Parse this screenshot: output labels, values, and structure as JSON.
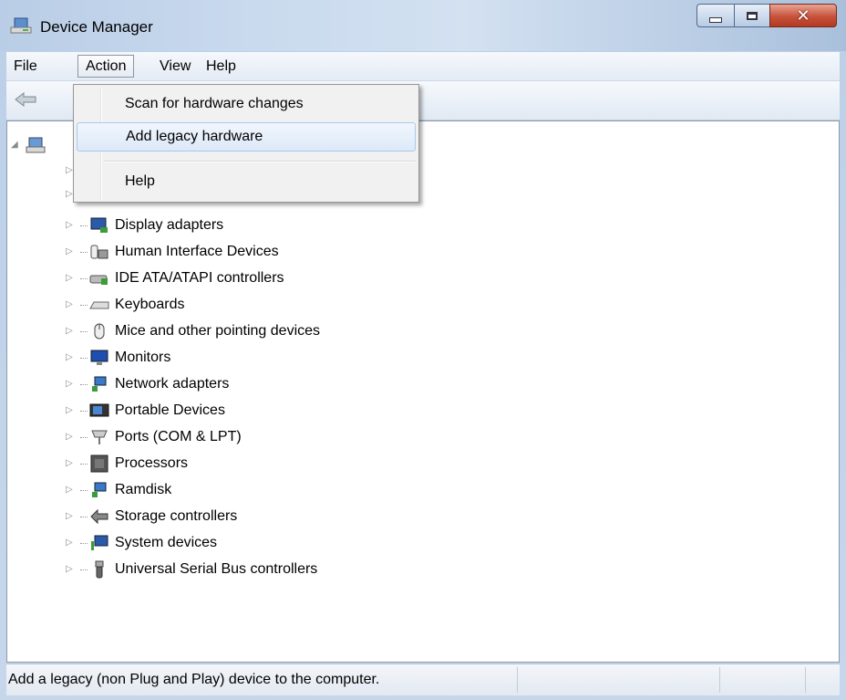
{
  "window": {
    "title": "Device Manager"
  },
  "menubar": {
    "items": [
      "File",
      "Action",
      "View",
      "Help"
    ],
    "active": "Action"
  },
  "action_menu": {
    "items": [
      "Scan for hardware changes",
      "Add legacy hardware",
      "Help"
    ],
    "highlighted": "Add legacy hardware"
  },
  "tree": {
    "items": [
      {
        "label": "Display adapters",
        "icon": "display-adapter-icon"
      },
      {
        "label": "Human Interface Devices",
        "icon": "hid-icon"
      },
      {
        "label": "IDE ATA/ATAPI controllers",
        "icon": "ide-controller-icon"
      },
      {
        "label": "Keyboards",
        "icon": "keyboard-icon"
      },
      {
        "label": "Mice and other pointing devices",
        "icon": "mouse-icon"
      },
      {
        "label": "Monitors",
        "icon": "monitor-icon"
      },
      {
        "label": "Network adapters",
        "icon": "network-adapter-icon"
      },
      {
        "label": "Portable Devices",
        "icon": "portable-device-icon"
      },
      {
        "label": "Ports (COM & LPT)",
        "icon": "port-icon"
      },
      {
        "label": "Processors",
        "icon": "processor-icon"
      },
      {
        "label": "Ramdisk",
        "icon": "ramdisk-icon"
      },
      {
        "label": "Storage controllers",
        "icon": "storage-controller-icon"
      },
      {
        "label": "System devices",
        "icon": "system-device-icon"
      },
      {
        "label": "Universal Serial Bus controllers",
        "icon": "usb-icon"
      }
    ]
  },
  "statusbar": {
    "text": "Add a legacy (non Plug and Play) device to the computer."
  }
}
